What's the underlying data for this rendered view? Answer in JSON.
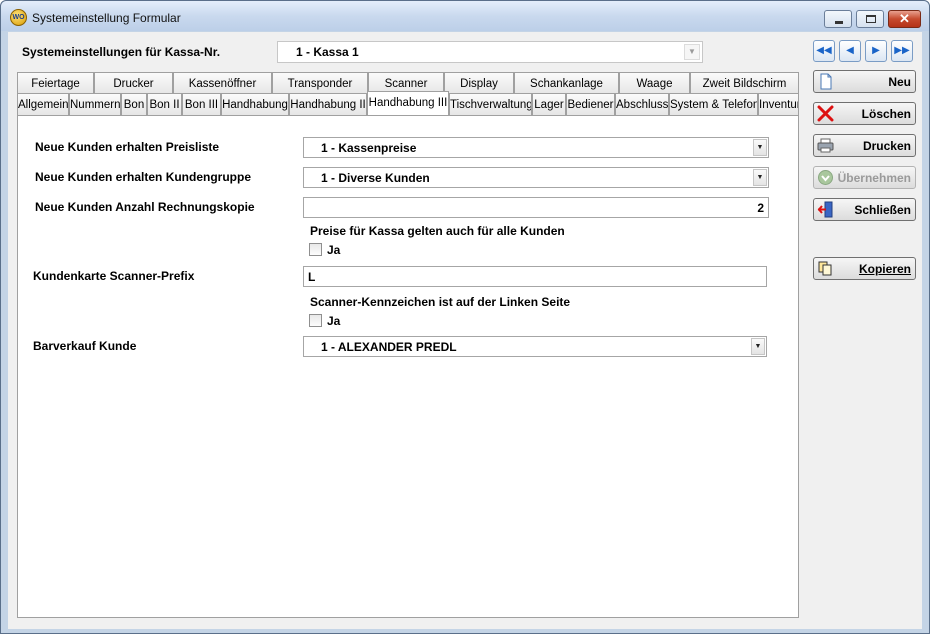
{
  "window": {
    "title": "Systemeinstellung Formular",
    "app_icon_text": "WO"
  },
  "header": {
    "kassa_label": "Systemeinstellungen für Kassa-Nr.",
    "kassa_value": "1 - Kassa 1"
  },
  "tabs_back": [
    "Feiertage",
    "Drucker",
    "Kassenöffner",
    "Transponder",
    "Scanner",
    "Display",
    "Schankanlage",
    "Waage",
    "Zweit Bildschirm"
  ],
  "tabs_front": [
    "Allgemein",
    "Nummern",
    "Bon",
    "Bon II",
    "Bon III",
    "Handhabung",
    "Handhabung II",
    "Handhabung III",
    "Tischverwaltung",
    "Lager",
    "Bediener",
    "Abschluss",
    "System & Telefon",
    "Inventur"
  ],
  "active_tab": "Handhabung III",
  "form": {
    "preisliste_label": "Neue Kunden erhalten Preisliste",
    "preisliste_value": "1 - Kassenpreise",
    "kundengruppe_label": "Neue Kunden erhalten Kundengruppe",
    "kundengruppe_value": "1 - Diverse Kunden",
    "rechnungskopie_label": "Neue Kunden Anzahl Rechnungskopie",
    "rechnungskopie_value": "2",
    "preise_kassa_label": "Preise für Kassa gelten auch für alle Kunden",
    "preise_kassa_check_label": "Ja",
    "scanner_prefix_label": "Kundenkarte Scanner-Prefix",
    "scanner_prefix_value": "L",
    "scanner_links_label": "Scanner-Kennzeichen ist auf der Linken Seite",
    "scanner_links_check_label": "Ja",
    "barverkauf_label": "Barverkauf Kunde",
    "barverkauf_value": "1 - ALEXANDER PREDL"
  },
  "side_buttons": {
    "neu": "Neu",
    "loeschen": "Löschen",
    "drucken": "Drucken",
    "uebernehmen": "Übernehmen",
    "schliessen": "Schließen",
    "kopieren": "Kopieren"
  },
  "colors": {
    "window_frame": "#c4d4e6",
    "close_red": "#c64a2e",
    "nav_blue": "#1a64c8"
  }
}
